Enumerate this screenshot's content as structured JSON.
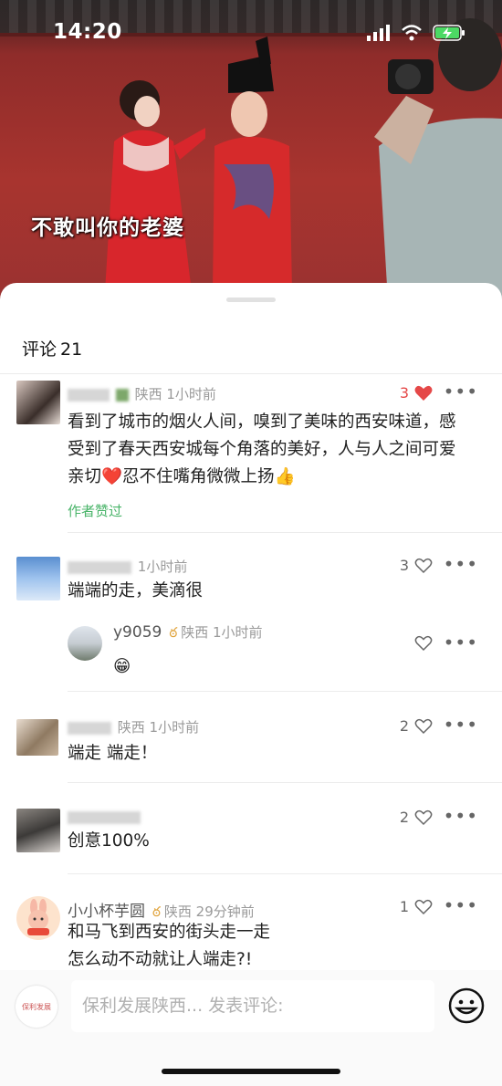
{
  "status_bar": {
    "time": "14:20"
  },
  "video": {
    "caption": "不敢叫你的老婆"
  },
  "comments_header": {
    "label": "评论",
    "count": "21"
  },
  "comments": [
    {
      "location_time": "陕西 1小时前",
      "text": "看到了城市的烟火人间，嗅到了美味的西安味道，感受到了春天西安城每个角落的美好，人与人之间可爱亲切❤️忍不住嘴角微微上扬👍",
      "author_liked": "作者赞过",
      "likes": "3",
      "liked": true
    },
    {
      "location_time": "1小时前",
      "text": "端端的走，美滴很",
      "likes": "3",
      "liked": false,
      "reply": {
        "name": "y9059",
        "location_time": "陕西 1小时前",
        "text": "😁",
        "likes": ""
      }
    },
    {
      "location_time": "陕西 1小时前",
      "text": "端走 端走！",
      "likes": "2",
      "liked": false
    },
    {
      "location_time": "",
      "text": "创意100%",
      "likes": "2",
      "liked": false
    },
    {
      "name": "小小杯芋圆",
      "location_time": "陕西 29分钟前",
      "text": "和马飞到西安的街头走一走\n怎么动不动就让人端走?!",
      "likes": "1",
      "liked": false
    }
  ],
  "input_bar": {
    "placeholder": "保利发展陕西... 发表评论:",
    "logo_text": "保利发展"
  },
  "colors": {
    "like_red": "#e54848",
    "author_liked_green": "#49b469",
    "badge_gold": "#e0a33b"
  }
}
